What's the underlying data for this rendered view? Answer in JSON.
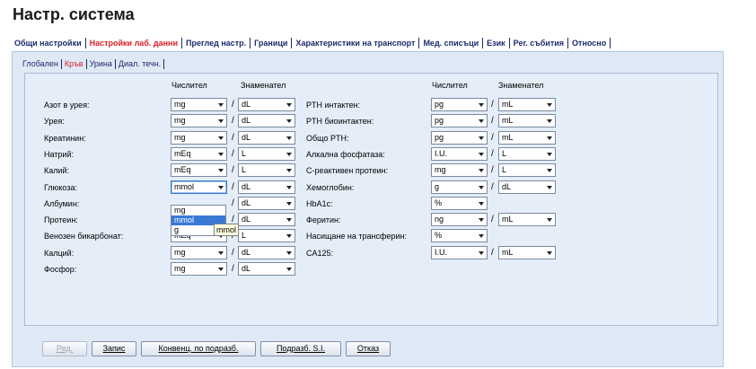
{
  "title": "Настр. система",
  "main_tabs": [
    {
      "label": "Общи настройки"
    },
    {
      "label": "Настройки лаб. данни",
      "active": true
    },
    {
      "label": "Преглед настр."
    },
    {
      "label": "Граници"
    },
    {
      "label": "Характеристики на транспорт"
    },
    {
      "label": "Мед. списъци"
    },
    {
      "label": "Език"
    },
    {
      "label": "Рег. събития"
    },
    {
      "label": "Относно"
    }
  ],
  "sub_tabs": [
    {
      "label": "Глобален"
    },
    {
      "label": "Кръв",
      "active": true
    },
    {
      "label": "Урина"
    },
    {
      "label": "Диал. течн."
    }
  ],
  "headers": {
    "numerator": "Числител",
    "denominator": "Знаменател"
  },
  "left_rows": [
    {
      "label": "Азот в урея:",
      "num": "mg",
      "den": "dL"
    },
    {
      "label": "Урея:",
      "num": "mg",
      "den": "dL"
    },
    {
      "label": "Креатинин:",
      "num": "mg",
      "den": "dL"
    },
    {
      "label": "Натрий:",
      "num": "mEq",
      "den": "L"
    },
    {
      "label": "Калий:",
      "num": "mEq",
      "den": "L"
    },
    {
      "label": "Глюкоза:",
      "num": "mmol",
      "den": "dL"
    },
    {
      "label": "Албумин:",
      "num": "",
      "den": "dL"
    },
    {
      "label": "Протеин:",
      "num": "",
      "den": "dL"
    },
    {
      "label": "Венозен бикарбонат:",
      "num": "mEq",
      "den": "L"
    },
    {
      "label": "Калций:",
      "num": "mg",
      "den": "dL"
    },
    {
      "label": "Фосфор:",
      "num": "mg",
      "den": "dL"
    }
  ],
  "right_rows": [
    {
      "label": "PTH интактен:",
      "num": "pg",
      "den": "mL"
    },
    {
      "label": "PTH биоинтактен:",
      "num": "pg",
      "den": "mL"
    },
    {
      "label": "Общо PTH:",
      "num": "pg",
      "den": "mL"
    },
    {
      "label": "Алкална фосфатаза:",
      "num": "I.U.",
      "den": "L"
    },
    {
      "label": "С-реактивен протеин:",
      "num": "mg",
      "den": "L"
    },
    {
      "label": "Хемоглобин:",
      "num": "g",
      "den": "dL"
    },
    {
      "label": "HbA1c:",
      "num": "%",
      "den": null
    },
    {
      "label": "Феритин:",
      "num": "ng",
      "den": "mL"
    },
    {
      "label": "Насищане на трансферин:",
      "num": "%",
      "den": null
    },
    {
      "label": "CA125:",
      "num": "I.U.",
      "den": "mL"
    }
  ],
  "dropdown": {
    "options": [
      "mg",
      "mmol",
      "g"
    ],
    "selected": "mmol"
  },
  "tooltip": "mmol",
  "buttons": [
    {
      "label": "Ред.",
      "disabled": true
    },
    {
      "label": "Запис"
    },
    {
      "label": "Конвенц. по подразб."
    },
    {
      "label": "Подразб. S.I."
    },
    {
      "label": "Отказ"
    }
  ]
}
